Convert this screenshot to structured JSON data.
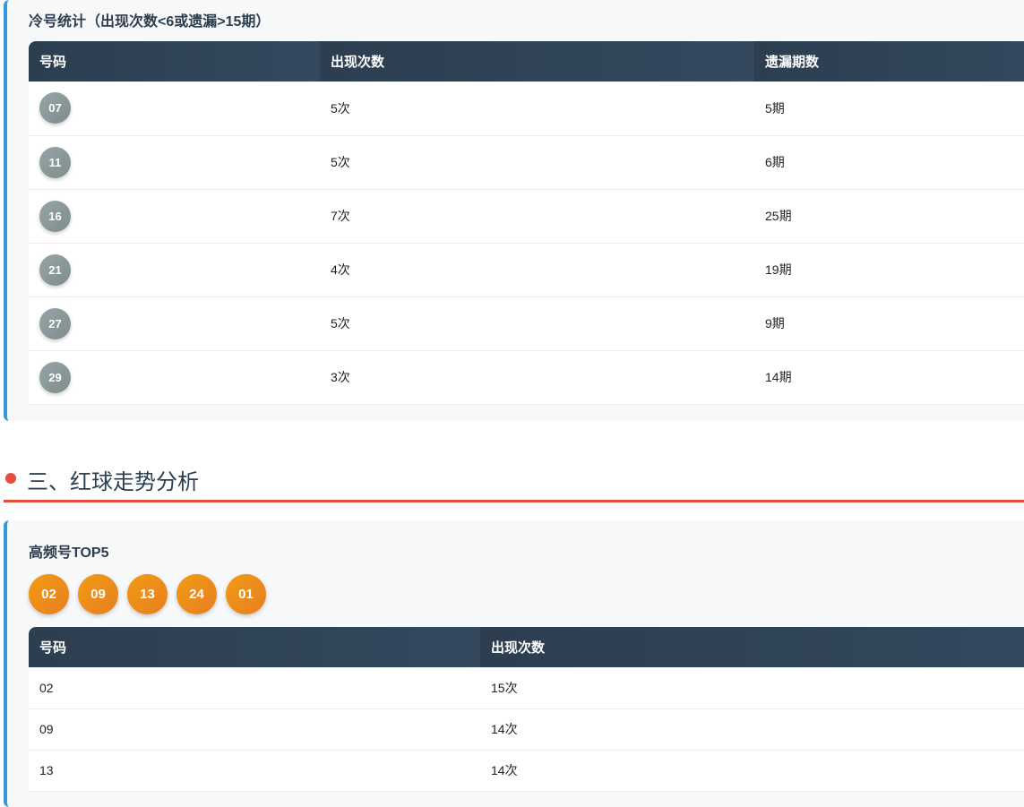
{
  "cold": {
    "title": "冷号统计（出现次数<6或遗漏>15期）",
    "headers": [
      "号码",
      "出现次数",
      "遗漏期数"
    ],
    "rows": [
      [
        "07",
        "5次",
        "5期"
      ],
      [
        "11",
        "5次",
        "6期"
      ],
      [
        "16",
        "7次",
        "25期"
      ],
      [
        "21",
        "4次",
        "19期"
      ],
      [
        "27",
        "5次",
        "9期"
      ],
      [
        "29",
        "3次",
        "14期"
      ]
    ]
  },
  "section": {
    "title": "三、红球走势分析"
  },
  "hot": {
    "title": "高频号TOP5",
    "balls": [
      "02",
      "09",
      "13",
      "24",
      "01"
    ],
    "headers": [
      "号码",
      "出现次数"
    ],
    "rows": [
      [
        "02",
        "15次"
      ],
      [
        "09",
        "14次"
      ],
      [
        "13",
        "14次"
      ]
    ]
  }
}
